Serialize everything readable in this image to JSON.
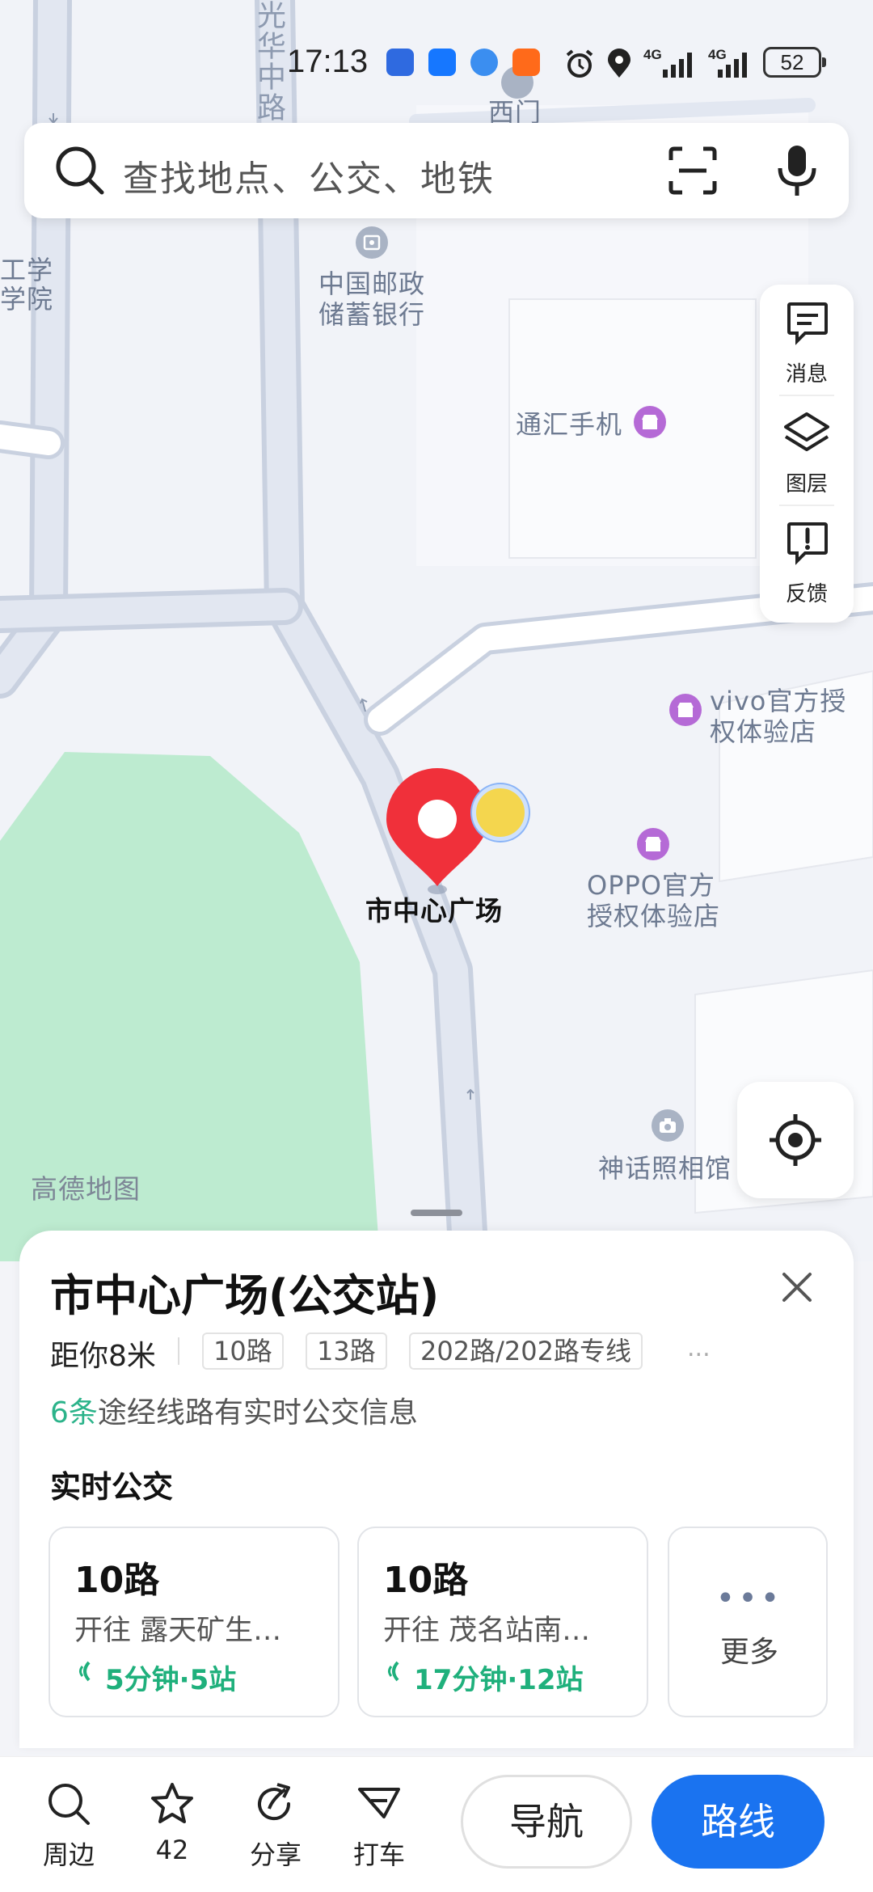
{
  "status_bar": {
    "time": "17:13",
    "signal_1": "4G",
    "signal_2": "4G",
    "battery": "52"
  },
  "search": {
    "placeholder": "查找地点、公交、地铁"
  },
  "map": {
    "watermark": "高德地图",
    "street_name": "光华中路",
    "selected_stop": "市中心广场",
    "pois": {
      "ximen": "西门",
      "postal_bank_1": "中国邮政",
      "postal_bank_2": "储蓄银行",
      "tonghui": "通汇手机",
      "vivo_1": "vivo官方授",
      "vivo_2": "权体验店",
      "oppo_1": "OPPO官方",
      "oppo_2": "授权体验店",
      "shenhua": "神话照相馆",
      "left_edge_1": "工学",
      "left_edge_2": "学院"
    }
  },
  "tools": {
    "message": "消息",
    "layers": "图层",
    "feedback": "反馈"
  },
  "sheet": {
    "title": "市中心广场(公交站)",
    "distance": "距你8米",
    "routes": [
      "10路",
      "13路",
      "202路/202路专线"
    ],
    "more": "...",
    "info_count": "6条",
    "info_text": "途经线路有实时公交信息",
    "realtime_title": "实时公交",
    "cards": [
      {
        "route": "10路",
        "dest": "开往 露天矿生…",
        "eta": "5分钟·5站"
      },
      {
        "route": "10路",
        "dest": "开往 茂名站南…",
        "eta": "17分钟·12站"
      }
    ],
    "more_card": {
      "dots": "•••",
      "label": "更多"
    }
  },
  "bottom_bar": {
    "nearby": "周边",
    "favorites": "42",
    "share": "分享",
    "taxi": "打车",
    "navigate": "导航",
    "route": "路线"
  },
  "colors": {
    "accent_blue": "#1a73f0",
    "eta_green": "#1fb07c",
    "pin_red": "#f0303a",
    "park_green": "#bdebd0"
  }
}
